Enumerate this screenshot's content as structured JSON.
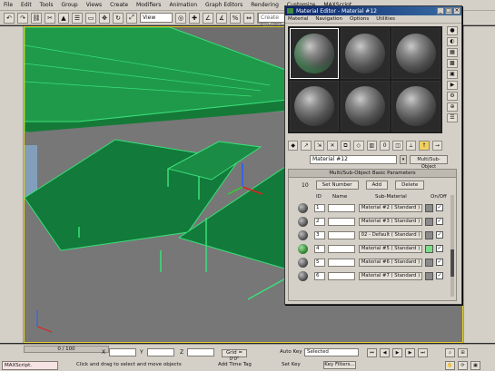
{
  "menubar": {
    "items": [
      "File",
      "Edit",
      "Tools",
      "Group",
      "Views",
      "Create",
      "Modifiers",
      "Animation",
      "Graph Editors",
      "Rendering",
      "Customize",
      "MAXScript"
    ]
  },
  "toolbar": {
    "view_combo": "View",
    "search_placeholder": "Create Selection Se"
  },
  "material_editor": {
    "title": "Material Editor - Material #12",
    "menu": [
      "Material",
      "Navigation",
      "Options",
      "Utilities"
    ],
    "material_name": "Material #12",
    "material_type": "Multi/Sub-Object",
    "rollout_title": "Multi/Sub-Object Basic Parameters",
    "count": "10",
    "set_number_label": "Set Number",
    "add_label": "Add",
    "delete_label": "Delete",
    "col_id": "ID",
    "col_name": "Name",
    "col_sub": "Sub-Material",
    "col_onoff": "On/Off",
    "rows": [
      {
        "id": "1",
        "sub": "Material #2  ( Standard )",
        "green": false
      },
      {
        "id": "2",
        "sub": "Material #3  ( Standard )",
        "green": false
      },
      {
        "id": "3",
        "sub": "02 - Default  ( Standard )",
        "green": false
      },
      {
        "id": "4",
        "sub": "Material #5  ( Standard )",
        "green": true
      },
      {
        "id": "5",
        "sub": "Material #6  ( Standard )",
        "green": false
      },
      {
        "id": "6",
        "sub": "Material #7  ( Standard )",
        "green": false
      }
    ]
  },
  "statusbar": {
    "time": "0 / 100",
    "maxscript": "MAXScript.",
    "prompt": "Click and drag to select and move objects",
    "x_label": "X",
    "y_label": "Y",
    "z_label": "Z",
    "grid": "Grid = 0'0\"",
    "add_time_tag": "Add Time Tag",
    "auto_key": "Auto Key",
    "selected": "Selected",
    "set_key": "Set Key",
    "key_filters": "Key Filters..."
  },
  "colors": {
    "object_green": "#1f9a4a",
    "wire_green": "#39e07a",
    "viewport_bg": "#6e6e6e"
  }
}
